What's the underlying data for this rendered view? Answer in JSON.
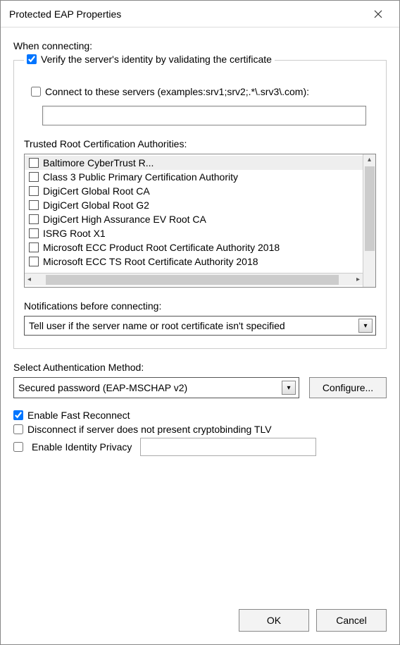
{
  "window_title": "Protected EAP Properties",
  "when_connecting_label": "When connecting:",
  "verify_identity": {
    "checked": true,
    "label": "Verify the server's identity by validating the certificate"
  },
  "connect_servers": {
    "checked": false,
    "label": "Connect to these servers (examples:srv1;srv2;.*\\.srv3\\.com):",
    "value": ""
  },
  "trusted_ca_label": "Trusted Root Certification Authorities:",
  "ca_list": [
    {
      "label": "Baltimore CyberTrust R...",
      "checked": false,
      "highlight": true
    },
    {
      "label": "Class 3 Public Primary Certification Authority",
      "checked": false
    },
    {
      "label": "DigiCert Global Root CA",
      "checked": false
    },
    {
      "label": "DigiCert Global Root G2",
      "checked": false
    },
    {
      "label": "DigiCert High Assurance EV Root CA",
      "checked": false
    },
    {
      "label": "ISRG Root X1",
      "checked": false
    },
    {
      "label": "Microsoft ECC Product Root Certificate Authority 2018",
      "checked": false
    },
    {
      "label": "Microsoft ECC TS Root Certificate Authority 2018",
      "checked": false
    }
  ],
  "notifications_label": "Notifications before connecting:",
  "notifications_selected": "Tell user if the server name or root certificate isn't specified",
  "auth_method_label": "Select Authentication Method:",
  "auth_method_selected": "Secured password (EAP-MSCHAP v2)",
  "configure_button": "Configure...",
  "enable_fast_reconnect": {
    "checked": true,
    "label": "Enable Fast Reconnect"
  },
  "disconnect_cryptobinding": {
    "checked": false,
    "label": "Disconnect if server does not present cryptobinding TLV"
  },
  "enable_identity_privacy": {
    "checked": false,
    "label": "Enable Identity Privacy",
    "value": ""
  },
  "ok_button": "OK",
  "cancel_button": "Cancel"
}
